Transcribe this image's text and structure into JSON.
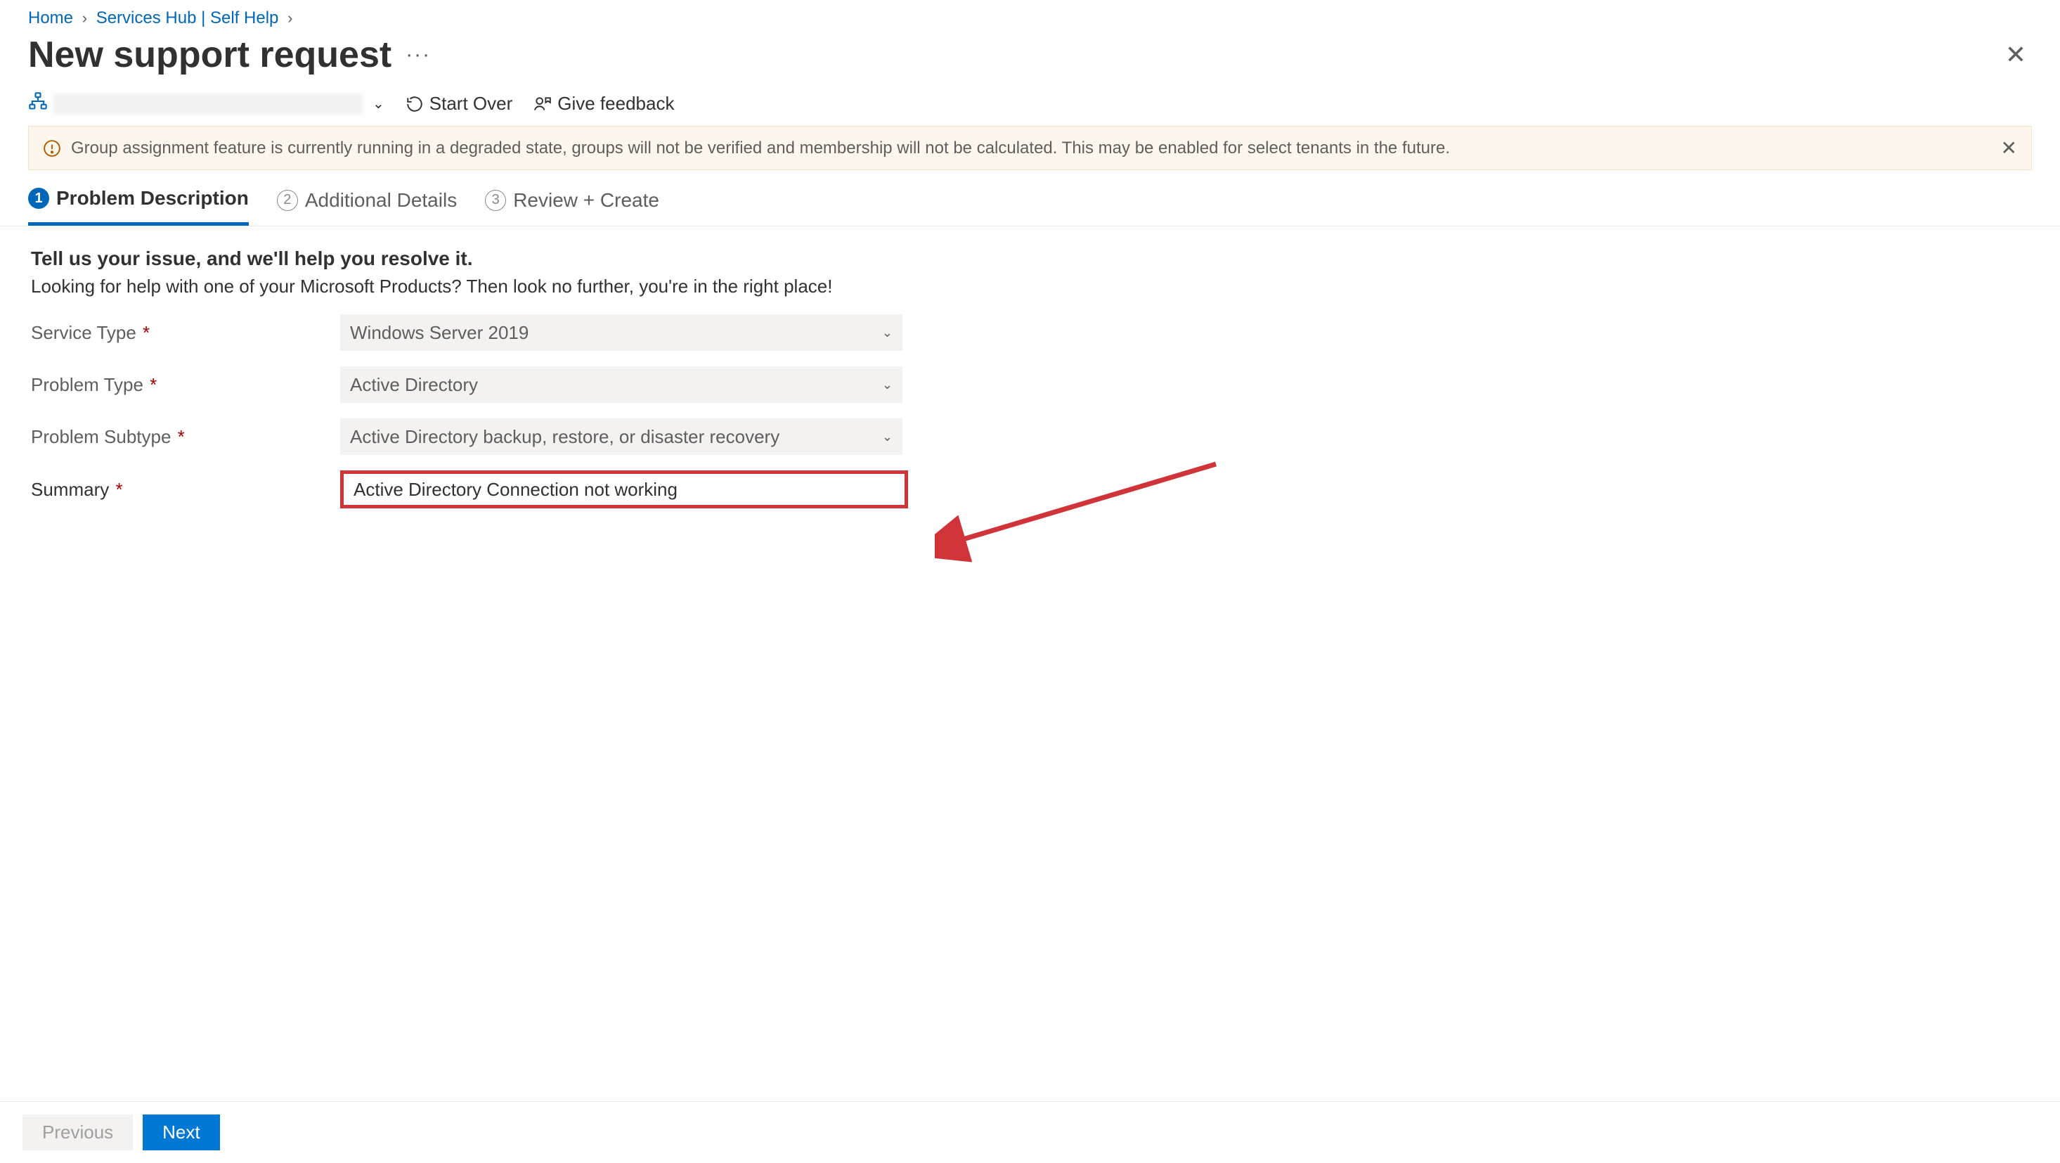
{
  "breadcrumbs": {
    "home": "Home",
    "services_hub": "Services Hub | Self Help"
  },
  "page_title": "New support request",
  "toolbar": {
    "start_over": "Start Over",
    "give_feedback": "Give feedback"
  },
  "banner": {
    "text": "Group assignment feature is currently running in a degraded state, groups will not be verified and membership will not be calculated. This may be enabled for select tenants in the future."
  },
  "tabs": {
    "t1_num": "1",
    "t1_label": "Problem Description",
    "t2_num": "2",
    "t2_label": "Additional Details",
    "t3_num": "3",
    "t3_label": "Review + Create"
  },
  "intro": {
    "strong": "Tell us your issue, and we'll help you resolve it.",
    "sub": "Looking for help with one of your Microsoft Products? Then look no further, you're in the right place!"
  },
  "fields": {
    "service_type_label": "Service Type",
    "service_type_value": "Windows Server 2019",
    "problem_type_label": "Problem Type",
    "problem_type_value": "Active Directory",
    "problem_subtype_label": "Problem Subtype",
    "problem_subtype_value": "Active Directory backup, restore, or disaster recovery",
    "summary_label": "Summary",
    "summary_value": "Active Directory Connection not working"
  },
  "footer": {
    "previous": "Previous",
    "next": "Next"
  }
}
